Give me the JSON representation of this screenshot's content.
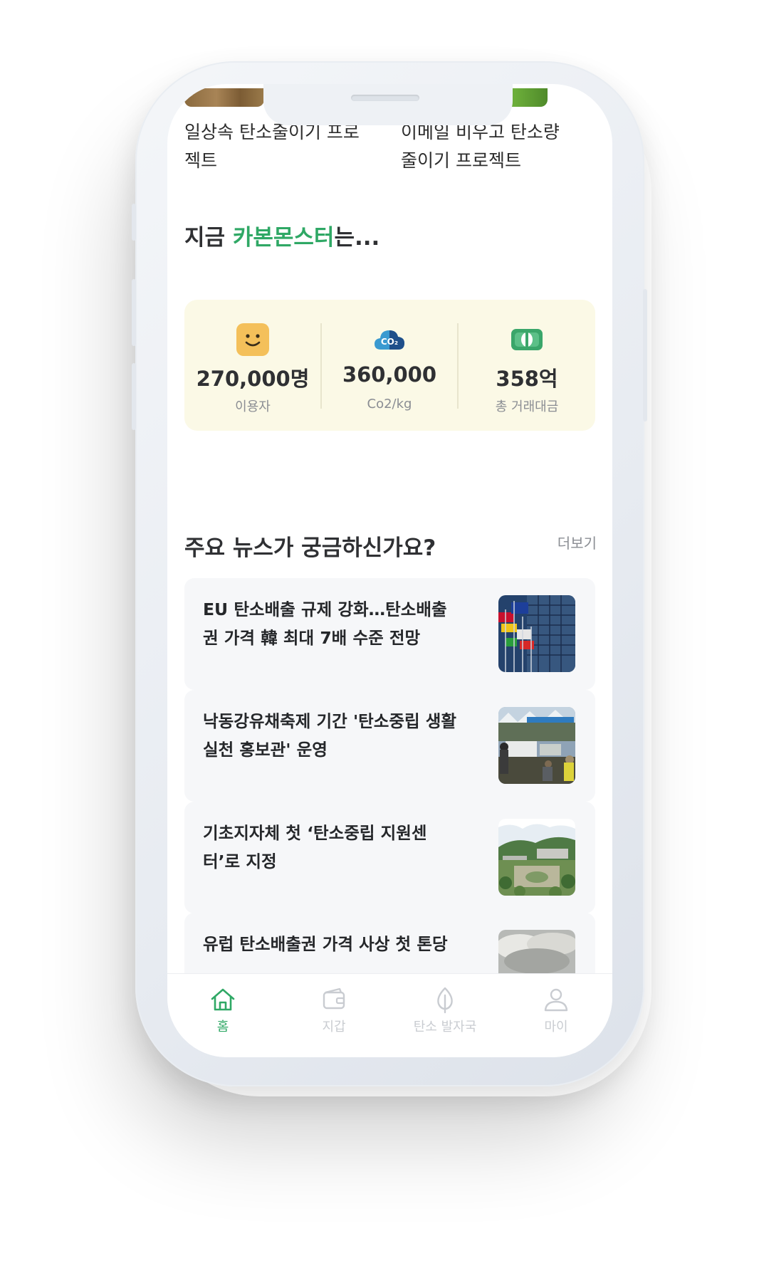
{
  "projects": [
    {
      "title": "일상속 탄소줄이기 프로젝트"
    },
    {
      "title": "이메일 비우고 탄소량 줄이기 프로젝트"
    }
  ],
  "status": {
    "title_prefix": "지금 ",
    "title_brand": "카본몬스터",
    "title_suffix": "는...",
    "stats": [
      {
        "value": "270,000명",
        "label": "이용자",
        "icon": "smiley-face-icon"
      },
      {
        "value": "360,000",
        "label": "Co2/kg",
        "icon": "co2-cloud-icon"
      },
      {
        "value": "358억",
        "label": "총 거래대금",
        "icon": "money-bill-icon"
      }
    ]
  },
  "news": {
    "title": "주요 뉴스가 궁금하신가요?",
    "more_label": "더보기",
    "items": [
      {
        "title": "EU 탄소배출 규제 강화…탄소배출권 가격 韓 최대 7배 수준 전망"
      },
      {
        "title": "낙동강유채축제 기간 '탄소중립 생활 실천 홍보관' 운영"
      },
      {
        "title": "기초지자체 첫 ‘탄소중립 지원센터’로 지정"
      },
      {
        "title": "유럽 탄소배출권 가격 사상 첫 톤당"
      }
    ]
  },
  "tabbar": {
    "tabs": [
      {
        "label": "홈",
        "icon": "home-icon",
        "active": true
      },
      {
        "label": "지갑",
        "icon": "wallet-icon",
        "active": false
      },
      {
        "label": "탄소 발자국",
        "icon": "leaf-icon",
        "active": false
      },
      {
        "label": "마이",
        "icon": "person-icon",
        "active": false
      }
    ]
  },
  "colors": {
    "brand_green": "#2fa865",
    "stats_background": "#fbf9e6",
    "card_background": "#f6f7f9",
    "inactive_tab": "#c9ccd1"
  }
}
